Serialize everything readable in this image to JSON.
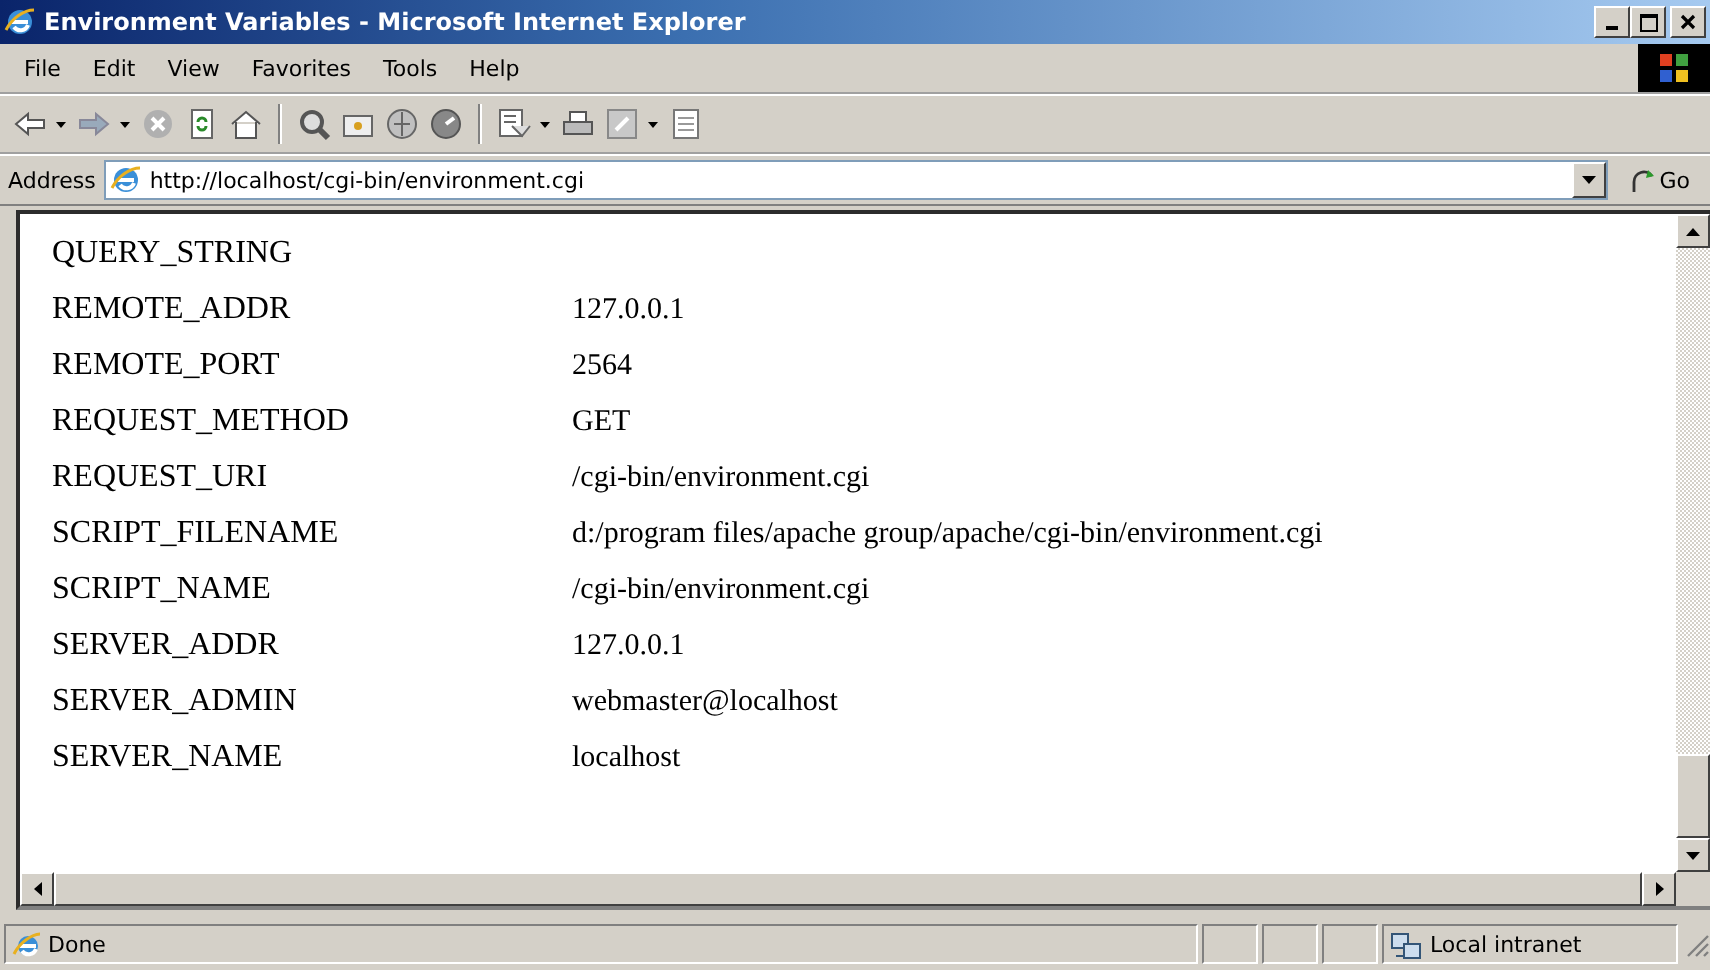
{
  "window": {
    "title": "Environment Variables - Microsoft Internet Explorer"
  },
  "menu": [
    "File",
    "Edit",
    "View",
    "Favorites",
    "Tools",
    "Help"
  ],
  "address_bar": {
    "label": "Address",
    "url": "http://localhost/cgi-bin/environment.cgi",
    "go": "Go"
  },
  "variables": [
    {
      "name": "QUERY_STRING"
    },
    {
      "name": "REMOTE_ADDR",
      "value": "127.0.0.1"
    },
    {
      "name": "REMOTE_PORT",
      "value": "2564"
    },
    {
      "name": "REQUEST_METHOD",
      "value": "GET"
    },
    {
      "name": "REQUEST_URI",
      "value": "/cgi-bin/environment.cgi"
    },
    {
      "name": "SCRIPT_FILENAME",
      "value": "d:/program files/apache group/apache/cgi-bin/environment.cgi"
    },
    {
      "name": "SCRIPT_NAME",
      "value": "/cgi-bin/environment.cgi"
    },
    {
      "name": "SERVER_ADDR",
      "value": "127.0.0.1"
    },
    {
      "name": "SERVER_ADMIN",
      "value": "webmaster@localhost"
    },
    {
      "name": "SERVER_NAME",
      "value": "localhost"
    }
  ],
  "status_bar": {
    "text": "Done",
    "zone": "Local intranet"
  }
}
